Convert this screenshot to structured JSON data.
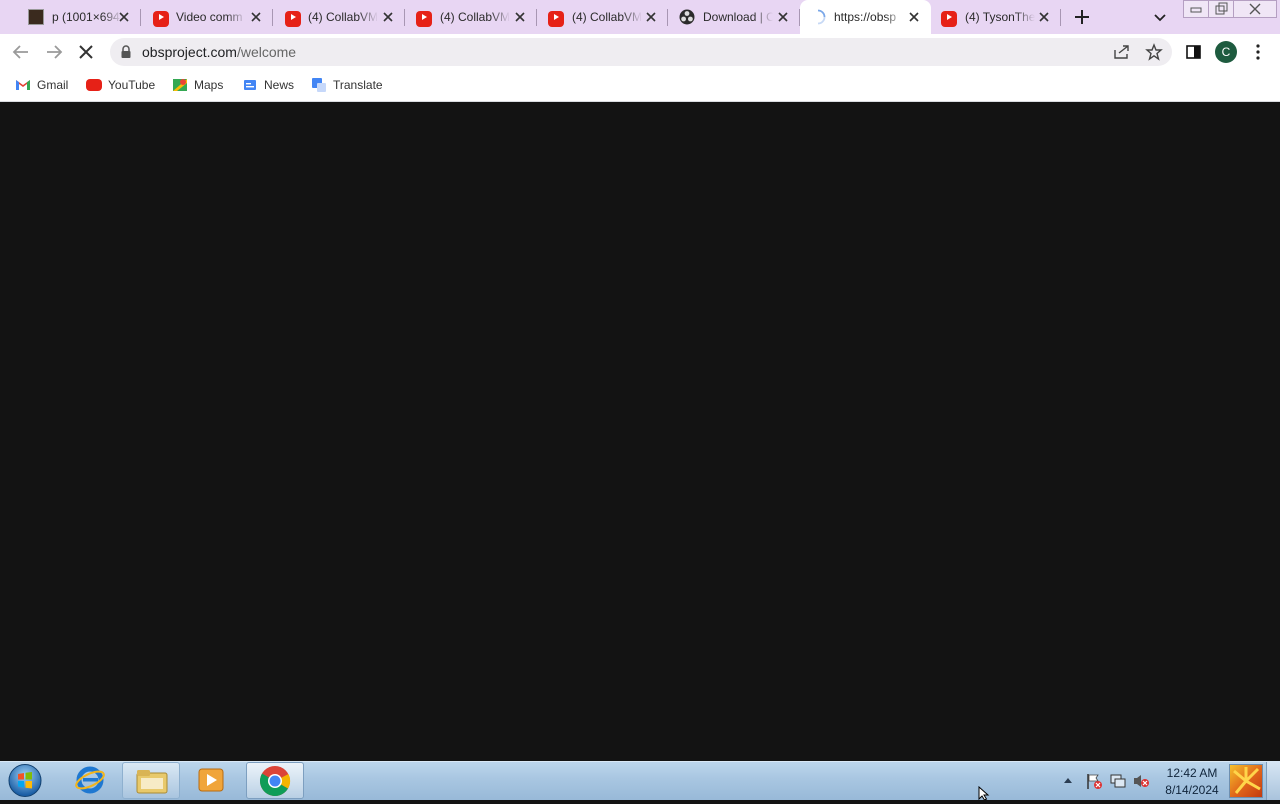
{
  "tabs": [
    {
      "title": "p (1001×694",
      "favicon": "image-thumbnail-icon",
      "active": false
    },
    {
      "title": "Video comm",
      "favicon": "youtube-icon",
      "active": false
    },
    {
      "title": "(4) CollabVM",
      "favicon": "youtube-icon",
      "active": false
    },
    {
      "title": "(4) CollabVM",
      "favicon": "youtube-icon",
      "active": false
    },
    {
      "title": "(4) CollabVM",
      "favicon": "youtube-icon",
      "active": false
    },
    {
      "title": "Download | O",
      "favicon": "obs-icon",
      "active": false
    },
    {
      "title": "https://obsp",
      "favicon": "loading-spinner-icon",
      "active": true
    },
    {
      "title": "(4) TysonThe",
      "favicon": "youtube-icon",
      "active": false
    }
  ],
  "address_bar": {
    "host": "obsproject.com",
    "path": "/welcome"
  },
  "profile": {
    "initial": "C",
    "color": "#1e5b3f"
  },
  "bookmarks": [
    {
      "label": "Gmail",
      "icon": "gmail-icon"
    },
    {
      "label": "YouTube",
      "icon": "youtube-icon"
    },
    {
      "label": "Maps",
      "icon": "maps-icon"
    },
    {
      "label": "News",
      "icon": "news-icon"
    },
    {
      "label": "Translate",
      "icon": "translate-icon"
    }
  ],
  "taskbar": {
    "apps": [
      "start-orb-icon",
      "internet-explorer-icon",
      "file-explorer-icon",
      "media-player-icon",
      "chrome-icon"
    ],
    "clock": {
      "time": "12:42 AM",
      "date": "8/14/2024"
    }
  },
  "colors": {
    "tabstrip": "#e8d6f3",
    "content": "#131313",
    "taskbar": "#a8c6e1"
  }
}
